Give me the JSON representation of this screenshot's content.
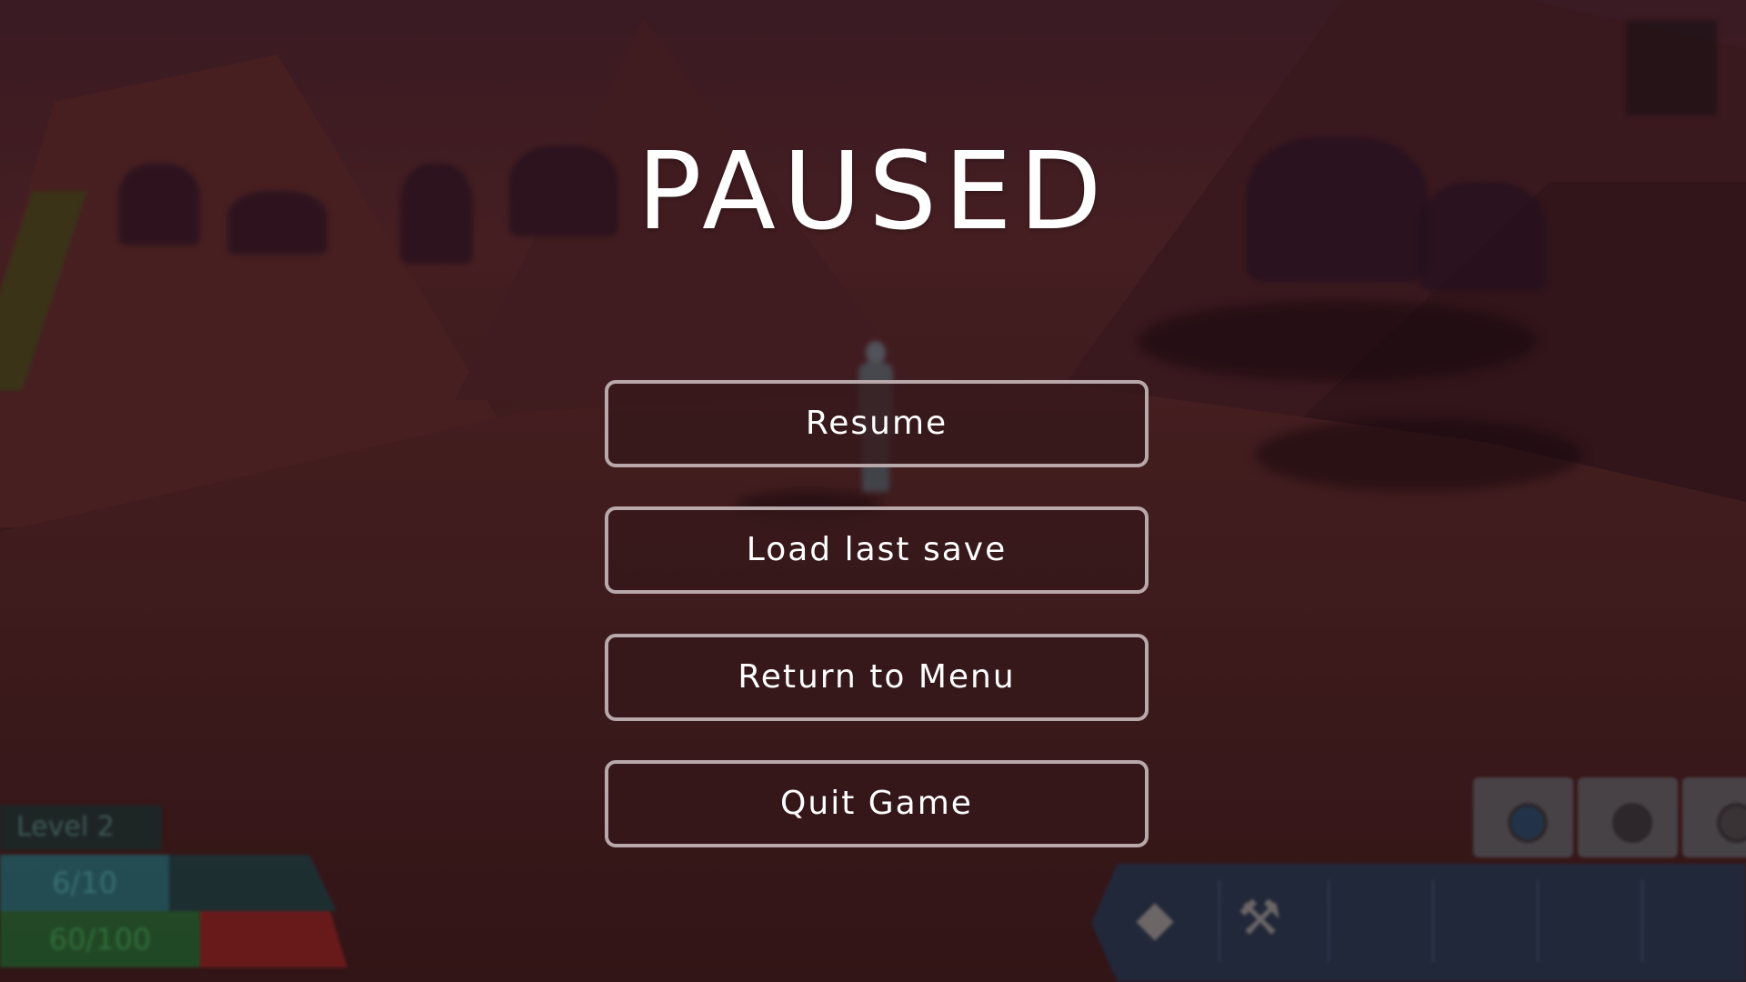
{
  "menu": {
    "title": "PAUSED",
    "buttons": [
      {
        "label": "Resume"
      },
      {
        "label": "Load last save"
      },
      {
        "label": "Return to Menu"
      },
      {
        "label": "Quit Game"
      }
    ]
  },
  "hud": {
    "level_label": "Level 2",
    "oxygen_text": "6/10",
    "oxygen_fraction": 0.6,
    "health_text": "60/100",
    "health_fraction": 0.6,
    "tools": [
      {
        "icon": "scanner-icon"
      },
      {
        "icon": "drill-icon"
      },
      {
        "icon": "tool-icon"
      }
    ],
    "hotbar_items": [
      {
        "icon": "ore-chunk-icon"
      },
      {
        "icon": "wrench-icon"
      },
      {
        "icon": "empty-slot"
      },
      {
        "icon": "empty-slot"
      },
      {
        "icon": "empty-slot"
      },
      {
        "icon": "empty-slot"
      }
    ]
  },
  "colors": {
    "button_border": "#b8a8aa",
    "button_fill": "#34181b",
    "title_text": "#ffffff",
    "oxygen_bar": "#1d5f66",
    "health_bar": "#1c5a2a",
    "health_missing": "#7a1c1c",
    "hotbar": "#1d2d42"
  }
}
